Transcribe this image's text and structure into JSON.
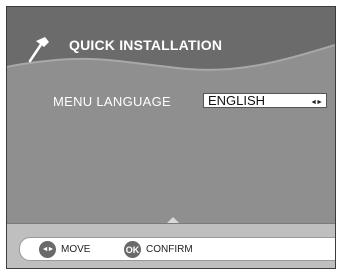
{
  "header": {
    "title": "QUICK INSTALLATION",
    "icon": "hammer-icon"
  },
  "menu": {
    "label": "MENU LANGUAGE",
    "value": "ENGLISH",
    "arrows": "◄►"
  },
  "footer": {
    "move_icon_glyph": "◄►",
    "move_label": "MOVE",
    "ok_icon_glyph": "OK",
    "confirm_label": "CONFIRM"
  },
  "colors": {
    "panel": "#8f8f8f",
    "footer": "#bfbfbf",
    "text": "#ffffff"
  }
}
